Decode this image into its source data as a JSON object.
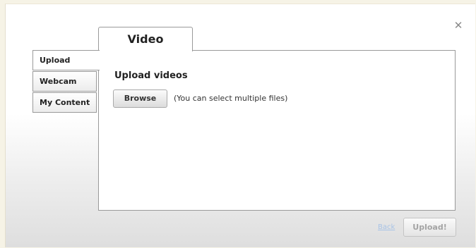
{
  "dialog": {
    "close_icon": "close-icon",
    "close_glyph": "✕"
  },
  "tabs": {
    "top_tab_label": "Video",
    "side_tabs": [
      {
        "label": "Upload",
        "active": true
      },
      {
        "label": "Webcam",
        "active": false
      },
      {
        "label": "My Content",
        "active": false
      }
    ]
  },
  "upload_panel": {
    "heading": "Upload videos",
    "browse_label": "Browse",
    "hint": "(You can select multiple files)"
  },
  "footer": {
    "back_label": "Back",
    "upload_label": "Upload!",
    "upload_enabled": false
  },
  "colors": {
    "link": "#a8c3e6",
    "disabled_text": "#a4a4a4",
    "border": "#9a9a9a"
  }
}
